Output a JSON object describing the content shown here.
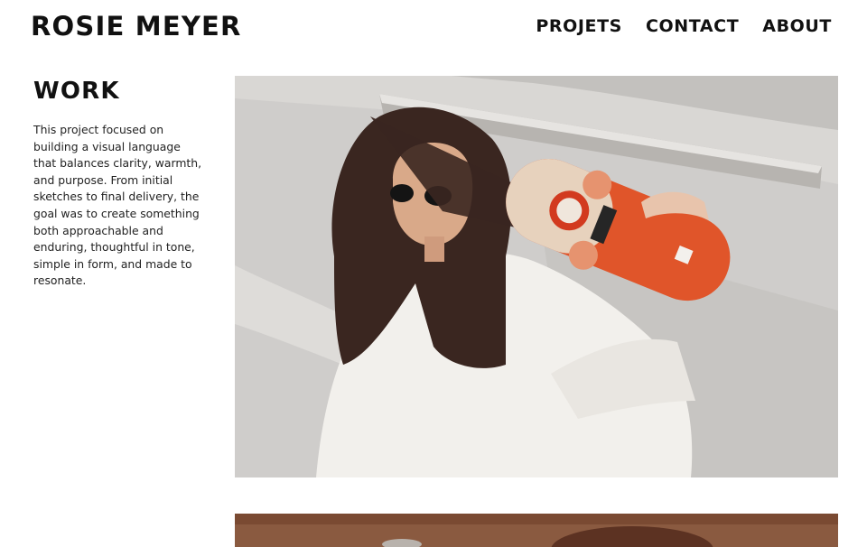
{
  "header": {
    "brand": "ROSIE MEYER",
    "nav": [
      {
        "label": "PROJETS"
      },
      {
        "label": "CONTACT"
      },
      {
        "label": "ABOUT"
      }
    ]
  },
  "main": {
    "heading": "WORK",
    "description": "This project focused on building a visual language that balances clarity, warmth, and purpose. From initial sketches to final delivery, the goal was to create something both approachable and enduring, thoughtful in tone, simple in form, and made to resonate."
  },
  "colors": {
    "text": "#111111",
    "background": "#ffffff",
    "skateboard_accent": "#e0552a"
  }
}
